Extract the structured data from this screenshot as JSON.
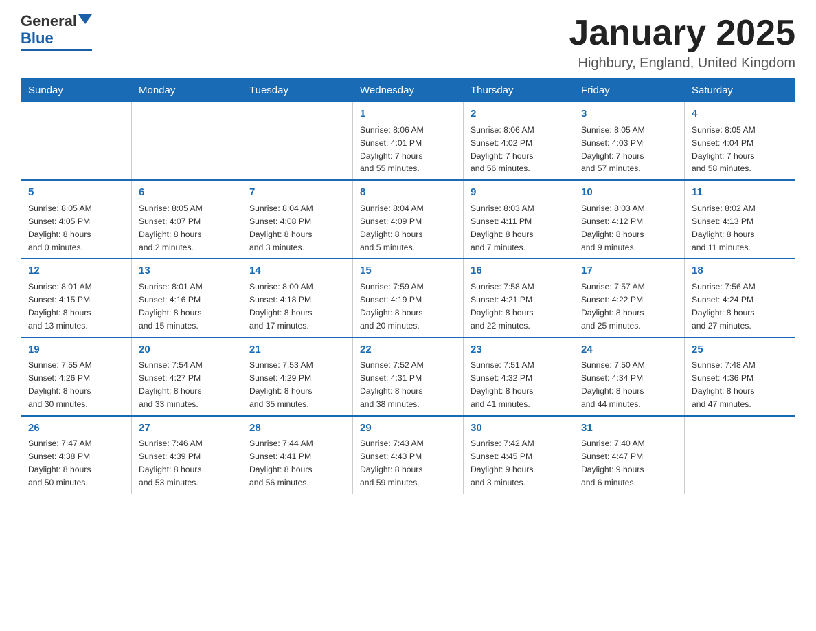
{
  "logo": {
    "general": "General",
    "blue": "Blue"
  },
  "header": {
    "title": "January 2025",
    "location": "Highbury, England, United Kingdom"
  },
  "days_of_week": [
    "Sunday",
    "Monday",
    "Tuesday",
    "Wednesday",
    "Thursday",
    "Friday",
    "Saturday"
  ],
  "weeks": [
    [
      {
        "day": "",
        "info": ""
      },
      {
        "day": "",
        "info": ""
      },
      {
        "day": "",
        "info": ""
      },
      {
        "day": "1",
        "info": "Sunrise: 8:06 AM\nSunset: 4:01 PM\nDaylight: 7 hours\nand 55 minutes."
      },
      {
        "day": "2",
        "info": "Sunrise: 8:06 AM\nSunset: 4:02 PM\nDaylight: 7 hours\nand 56 minutes."
      },
      {
        "day": "3",
        "info": "Sunrise: 8:05 AM\nSunset: 4:03 PM\nDaylight: 7 hours\nand 57 minutes."
      },
      {
        "day": "4",
        "info": "Sunrise: 8:05 AM\nSunset: 4:04 PM\nDaylight: 7 hours\nand 58 minutes."
      }
    ],
    [
      {
        "day": "5",
        "info": "Sunrise: 8:05 AM\nSunset: 4:05 PM\nDaylight: 8 hours\nand 0 minutes."
      },
      {
        "day": "6",
        "info": "Sunrise: 8:05 AM\nSunset: 4:07 PM\nDaylight: 8 hours\nand 2 minutes."
      },
      {
        "day": "7",
        "info": "Sunrise: 8:04 AM\nSunset: 4:08 PM\nDaylight: 8 hours\nand 3 minutes."
      },
      {
        "day": "8",
        "info": "Sunrise: 8:04 AM\nSunset: 4:09 PM\nDaylight: 8 hours\nand 5 minutes."
      },
      {
        "day": "9",
        "info": "Sunrise: 8:03 AM\nSunset: 4:11 PM\nDaylight: 8 hours\nand 7 minutes."
      },
      {
        "day": "10",
        "info": "Sunrise: 8:03 AM\nSunset: 4:12 PM\nDaylight: 8 hours\nand 9 minutes."
      },
      {
        "day": "11",
        "info": "Sunrise: 8:02 AM\nSunset: 4:13 PM\nDaylight: 8 hours\nand 11 minutes."
      }
    ],
    [
      {
        "day": "12",
        "info": "Sunrise: 8:01 AM\nSunset: 4:15 PM\nDaylight: 8 hours\nand 13 minutes."
      },
      {
        "day": "13",
        "info": "Sunrise: 8:01 AM\nSunset: 4:16 PM\nDaylight: 8 hours\nand 15 minutes."
      },
      {
        "day": "14",
        "info": "Sunrise: 8:00 AM\nSunset: 4:18 PM\nDaylight: 8 hours\nand 17 minutes."
      },
      {
        "day": "15",
        "info": "Sunrise: 7:59 AM\nSunset: 4:19 PM\nDaylight: 8 hours\nand 20 minutes."
      },
      {
        "day": "16",
        "info": "Sunrise: 7:58 AM\nSunset: 4:21 PM\nDaylight: 8 hours\nand 22 minutes."
      },
      {
        "day": "17",
        "info": "Sunrise: 7:57 AM\nSunset: 4:22 PM\nDaylight: 8 hours\nand 25 minutes."
      },
      {
        "day": "18",
        "info": "Sunrise: 7:56 AM\nSunset: 4:24 PM\nDaylight: 8 hours\nand 27 minutes."
      }
    ],
    [
      {
        "day": "19",
        "info": "Sunrise: 7:55 AM\nSunset: 4:26 PM\nDaylight: 8 hours\nand 30 minutes."
      },
      {
        "day": "20",
        "info": "Sunrise: 7:54 AM\nSunset: 4:27 PM\nDaylight: 8 hours\nand 33 minutes."
      },
      {
        "day": "21",
        "info": "Sunrise: 7:53 AM\nSunset: 4:29 PM\nDaylight: 8 hours\nand 35 minutes."
      },
      {
        "day": "22",
        "info": "Sunrise: 7:52 AM\nSunset: 4:31 PM\nDaylight: 8 hours\nand 38 minutes."
      },
      {
        "day": "23",
        "info": "Sunrise: 7:51 AM\nSunset: 4:32 PM\nDaylight: 8 hours\nand 41 minutes."
      },
      {
        "day": "24",
        "info": "Sunrise: 7:50 AM\nSunset: 4:34 PM\nDaylight: 8 hours\nand 44 minutes."
      },
      {
        "day": "25",
        "info": "Sunrise: 7:48 AM\nSunset: 4:36 PM\nDaylight: 8 hours\nand 47 minutes."
      }
    ],
    [
      {
        "day": "26",
        "info": "Sunrise: 7:47 AM\nSunset: 4:38 PM\nDaylight: 8 hours\nand 50 minutes."
      },
      {
        "day": "27",
        "info": "Sunrise: 7:46 AM\nSunset: 4:39 PM\nDaylight: 8 hours\nand 53 minutes."
      },
      {
        "day": "28",
        "info": "Sunrise: 7:44 AM\nSunset: 4:41 PM\nDaylight: 8 hours\nand 56 minutes."
      },
      {
        "day": "29",
        "info": "Sunrise: 7:43 AM\nSunset: 4:43 PM\nDaylight: 8 hours\nand 59 minutes."
      },
      {
        "day": "30",
        "info": "Sunrise: 7:42 AM\nSunset: 4:45 PM\nDaylight: 9 hours\nand 3 minutes."
      },
      {
        "day": "31",
        "info": "Sunrise: 7:40 AM\nSunset: 4:47 PM\nDaylight: 9 hours\nand 6 minutes."
      },
      {
        "day": "",
        "info": ""
      }
    ]
  ]
}
